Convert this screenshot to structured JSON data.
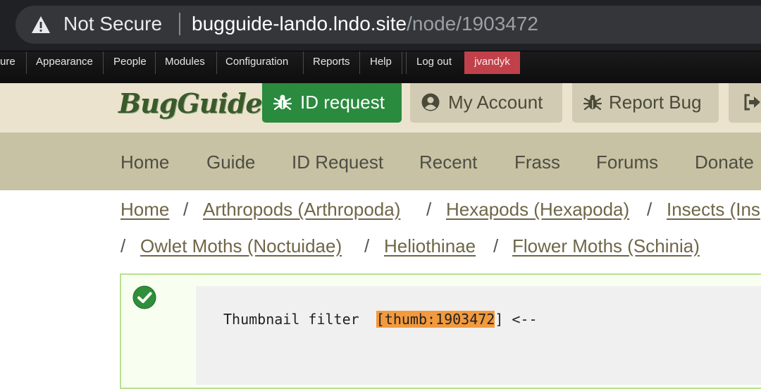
{
  "browser": {
    "security_label": "Not Secure",
    "url_host": "bugguide-lando.lndo.site",
    "url_path": "/node/1903472"
  },
  "admin_toolbar": {
    "items": [
      "ure",
      "Appearance",
      "People",
      "Modules",
      "Configuration",
      "Reports",
      "Help",
      "Log out"
    ],
    "user": "jvandyk"
  },
  "header": {
    "logo": "BugGuide",
    "buttons": {
      "id_request": "ID request",
      "my_account": "My Account",
      "report_bug": "Report Bug"
    }
  },
  "nav": [
    "Home",
    "Guide",
    "ID Request",
    "Recent",
    "Frass",
    "Forums",
    "Donate"
  ],
  "breadcrumb": [
    "Home",
    "Arthropods (Arthropoda)",
    "Hexapods (Hexapoda)",
    "Insects (Ins",
    "Owlet Moths (Noctuidae)",
    "Heliothinae",
    "Flower Moths (Schinia)"
  ],
  "breadcrumb_separator": "/",
  "message": {
    "prefix": "Thumbnail filter  ",
    "highlight": "[thumb:1903472",
    "suffix": "] <--"
  },
  "colors": {
    "id_request_bg": "#2a8a3e",
    "admin_user_tab": "#c1414a",
    "highlight": "#f29a3d",
    "status_border": "#b8e08f"
  }
}
